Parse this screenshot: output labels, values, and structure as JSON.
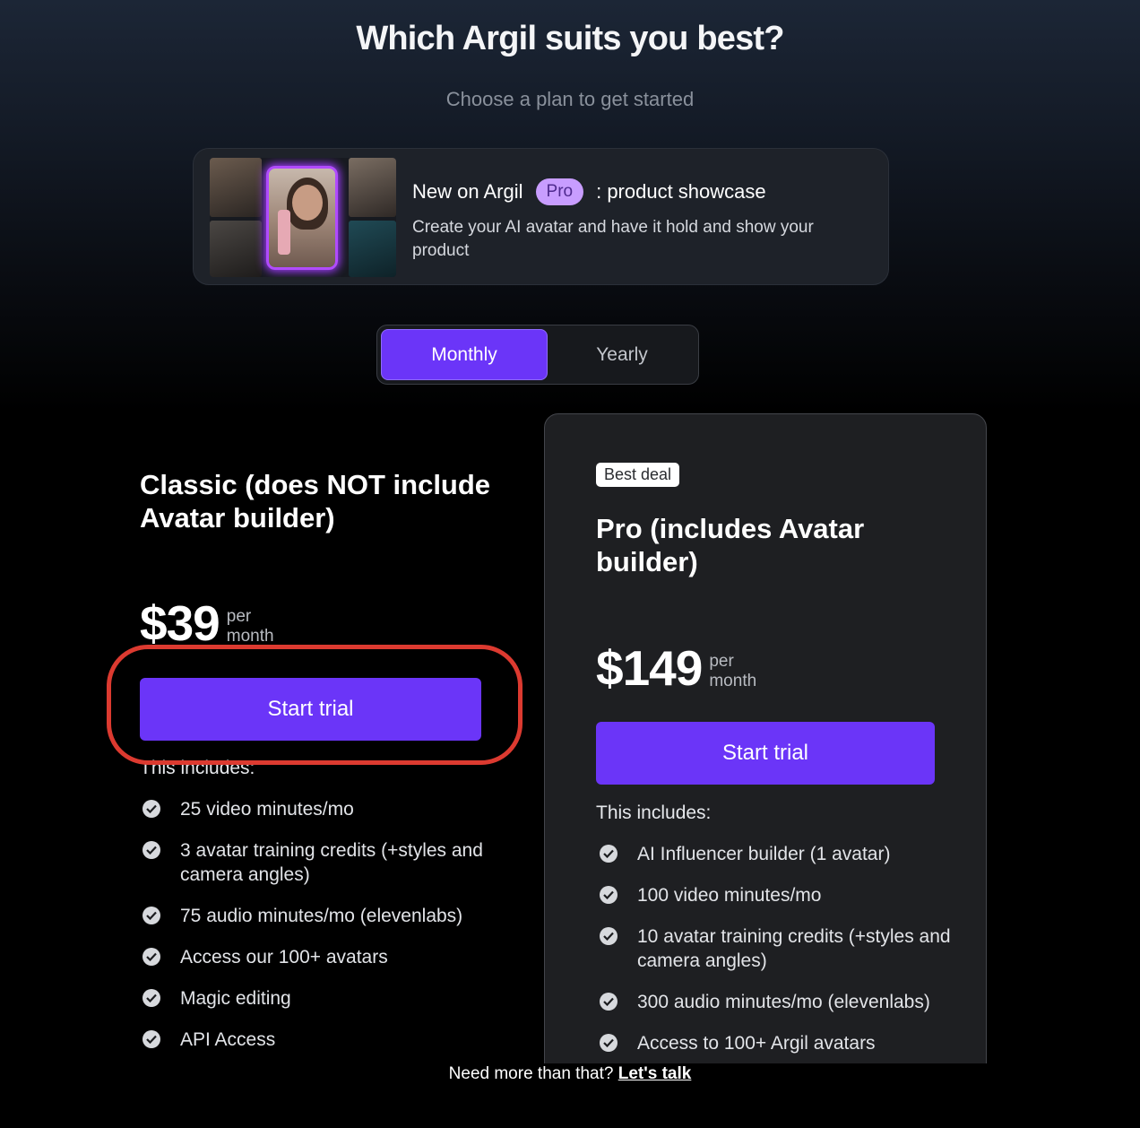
{
  "header": {
    "title": "Which Argil suits you best?",
    "subtitle": "Choose a plan to get started"
  },
  "banner": {
    "prefix": "New on Argil",
    "pill": "Pro",
    "suffix": ": product showcase",
    "description": "Create your AI avatar and have it hold and show your product"
  },
  "billing_toggle": {
    "monthly": "Monthly",
    "yearly": "Yearly",
    "selected": "Monthly"
  },
  "plans": {
    "classic": {
      "name": "Classic (does NOT include Avatar builder)",
      "price": "$39",
      "per": "per",
      "period": "month",
      "cta": "Start trial",
      "includes_label": "This includes:",
      "features": [
        "25 video minutes/mo",
        "3 avatar training credits (+styles and camera angles)",
        "75 audio minutes/mo (elevenlabs)",
        "Access our 100+ avatars",
        "Magic editing",
        "API Access"
      ]
    },
    "pro": {
      "badge": "Best deal",
      "name": "Pro (includes Avatar builder)",
      "price": "$149",
      "per": "per",
      "period": "month",
      "cta": "Start trial",
      "includes_label": "This includes:",
      "features": [
        "AI Influencer builder (1 avatar)",
        "100 video minutes/mo",
        "10 avatar training credits (+styles and camera angles)",
        "300 audio minutes/mo (elevenlabs)",
        "Access to 100+ Argil avatars"
      ]
    }
  },
  "footer": {
    "text": "Need more than that?",
    "link": "Let's talk"
  },
  "colors": {
    "accent": "#6b35f8",
    "highlight": "#dc3a30",
    "pill_bg": "#c89dff"
  },
  "icons": {
    "feature_check": "check-circle-icon"
  }
}
